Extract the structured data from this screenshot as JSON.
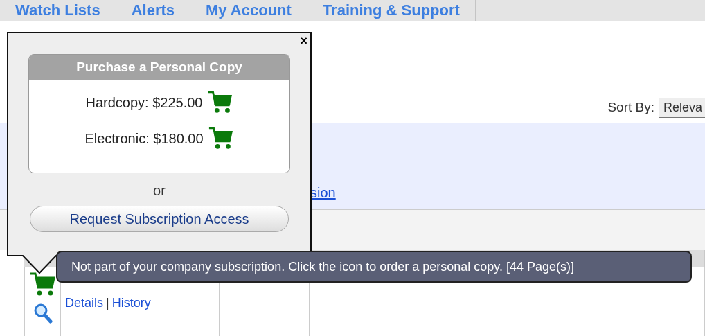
{
  "nav_tabs": [
    {
      "label": "Watch Lists",
      "selected": false
    },
    {
      "label": "Alerts",
      "selected": false
    },
    {
      "label": "My Account",
      "selected": false
    },
    {
      "label": "Training & Support",
      "selected": false
    }
  ],
  "sort": {
    "label": "Sort By:",
    "value": "Releva"
  },
  "info_panel": {
    "link": "sion"
  },
  "results": [
    {
      "links": [
        "Details",
        "History"
      ],
      "link_separator": "|"
    }
  ],
  "popup": {
    "close": "×",
    "title": "Purchase a Personal Copy",
    "prices": [
      {
        "label": "Hardcopy: $225.00"
      },
      {
        "label": "Electronic: $180.00"
      }
    ],
    "separator": "or",
    "button": "Request Subscription Access"
  },
  "tooltip": {
    "text": "Not part of your company subscription. Click the icon to order a personal copy. [44 Page(s)]"
  }
}
